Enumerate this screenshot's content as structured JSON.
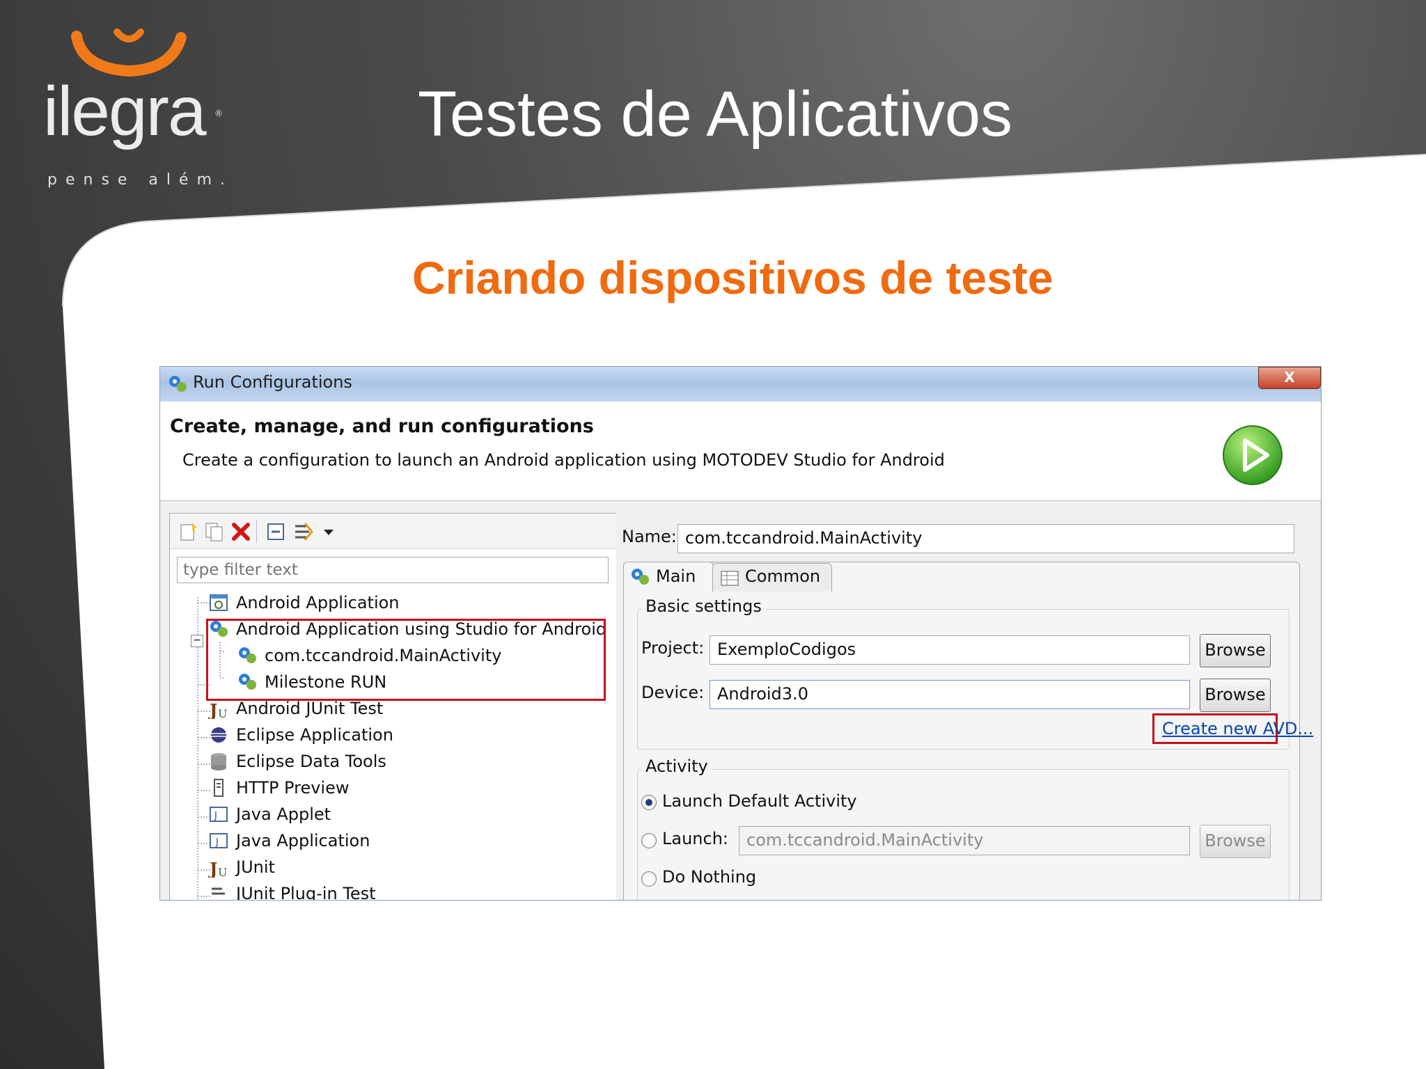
{
  "slide": {
    "brand": "ilegra",
    "tagline": "pense além.",
    "title": "Testes de Aplicativos",
    "subtitle": "Criando dispositivos de teste",
    "accent_color": "#f06a10"
  },
  "dialog": {
    "window_title": "Run Configurations",
    "close_label": "X",
    "header_title": "Create, manage, and run configurations",
    "header_description": "Create a configuration to launch an Android application using MOTODEV Studio for Android",
    "toolbar_icons": [
      "new-configuration-icon",
      "duplicate-icon",
      "delete-icon",
      "collapse-all-icon",
      "filter-icon",
      "dropdown-arrow-icon"
    ],
    "filter_placeholder": "type filter text",
    "tree": [
      {
        "label": "Android Application",
        "icon": "android-app-icon"
      },
      {
        "label": "Android Application using Studio for Android",
        "icon": "motodev-icon"
      },
      {
        "label": "com.tccandroid.MainActivity",
        "icon": "motodev-config-icon"
      },
      {
        "label": "Milestone RUN",
        "icon": "motodev-config-icon"
      },
      {
        "label": "Android JUnit Test",
        "icon": "junit-icon"
      },
      {
        "label": "Eclipse Application",
        "icon": "eclipse-icon"
      },
      {
        "label": "Eclipse Data Tools",
        "icon": "database-icon"
      },
      {
        "label": "HTTP Preview",
        "icon": "http-icon"
      },
      {
        "label": "Java Applet",
        "icon": "java-applet-icon"
      },
      {
        "label": "Java Application",
        "icon": "java-app-icon"
      },
      {
        "label": "JUnit",
        "icon": "junit-icon"
      },
      {
        "label": "JUnit Plug-in Test",
        "icon": "plugin-test-icon"
      }
    ],
    "name_label": "Name:",
    "name_value": "com.tccandroid.MainActivity",
    "tabs": [
      {
        "label": "Main",
        "icon": "motodev-icon"
      },
      {
        "label": "Common",
        "icon": "common-tab-icon"
      }
    ],
    "basic_settings_label": "Basic settings",
    "project_label": "Project:",
    "project_value": "ExemploCodigos",
    "device_label": "Device:",
    "device_value": "Android3.0",
    "browse_label": "Browse",
    "create_avd_link": "Create new AVD...",
    "activity_label": "Activity",
    "launch_default_label": "Launch Default Activity",
    "launch_label": "Launch:",
    "launch_value": "com.tccandroid.MainActivity",
    "do_nothing_label": "Do Nothing",
    "selected_activity_option": "Launch Default Activity",
    "highlight_color": "#c8101a",
    "link_color": "#0645ad"
  }
}
